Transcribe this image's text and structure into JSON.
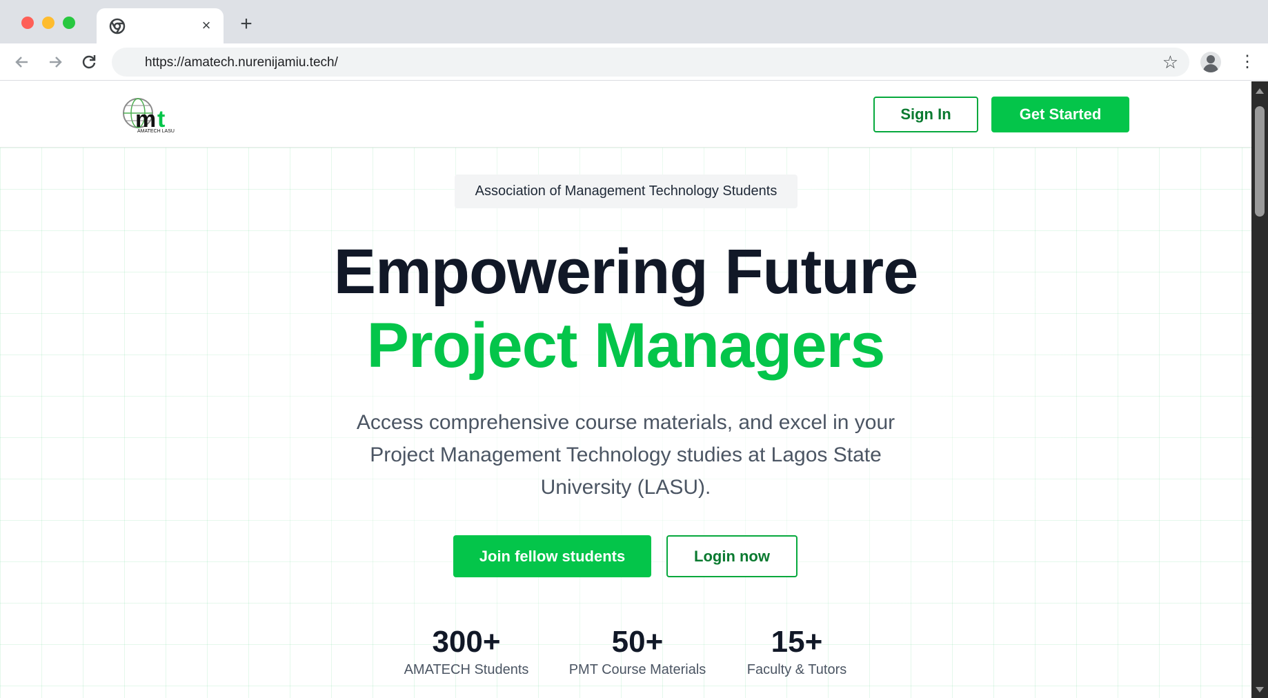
{
  "browser": {
    "url": "https://amatech.nurenijamiu.tech/",
    "new_tab_symbol": "+",
    "close_tab_symbol": "×"
  },
  "header": {
    "logo_text": "mt",
    "logo_subtext": "AMATECH LASU",
    "sign_in_label": "Sign In",
    "get_started_label": "Get Started"
  },
  "hero": {
    "badge": "Association of Management Technology Students",
    "title_line1": "Empowering Future",
    "title_line2": "Project Managers",
    "subtitle": "Access comprehensive course materials, and excel in your Project Management Technology studies at Lagos State University (LASU).",
    "primary_cta": "Join fellow students",
    "secondary_cta": "Login now"
  },
  "stats": [
    {
      "value": "300+",
      "label": "AMATECH Students"
    },
    {
      "value": "50+",
      "label": "PMT Course Materials"
    },
    {
      "value": "15+",
      "label": "Faculty & Tutors"
    }
  ],
  "colors": {
    "brand_green": "#04c54a",
    "dark_text": "#111827",
    "muted_text": "#4b5563"
  }
}
